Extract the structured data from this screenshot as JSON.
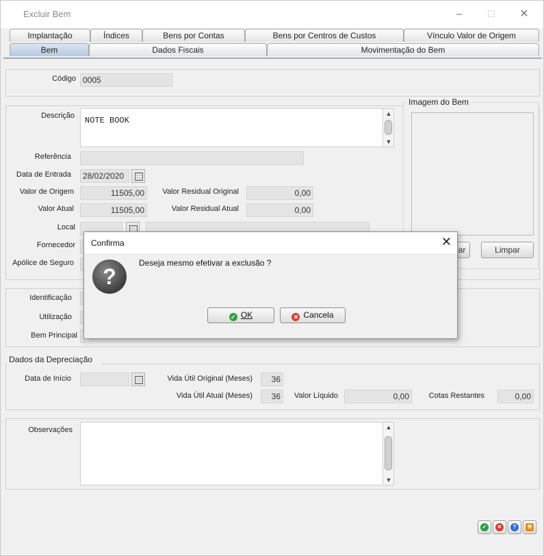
{
  "window": {
    "title": "Excluir Bem"
  },
  "tabs_row1": [
    "Implantação",
    "Índices",
    "Bens por Contas",
    "Bens por Centros de Custos",
    "Vínculo Valor de Origem"
  ],
  "tabs_row2": [
    "Bem",
    "Dados Fiscais",
    "Movimentação do Bem"
  ],
  "form": {
    "codigo": {
      "label": "Código",
      "value": "0005"
    },
    "descricao": {
      "label": "Descrição",
      "value": "NOTE BOOK"
    },
    "referencia": {
      "label": "Referência",
      "value": ""
    },
    "data_entrada": {
      "label": "Data de Entrada",
      "value": "28/02/2020"
    },
    "valor_origem": {
      "label": "Valor de Origem",
      "value": "11505,00"
    },
    "valor_atual": {
      "label": "Valor Atual",
      "value": "11505,00"
    },
    "valor_residual_original": {
      "label": "Valor Residual Original",
      "value": "0,00"
    },
    "valor_residual_atual": {
      "label": "Valor Residual Atual",
      "value": "0,00"
    },
    "local": {
      "label": "Local"
    },
    "fornecedor": {
      "label": "Fornecedor"
    },
    "apolice": {
      "label": "Apólice de Seguro"
    },
    "imagem": {
      "title": "Imagem do Bem",
      "hidden_button_label": "ar",
      "limpar_label": "Limpar"
    }
  },
  "grupo2": {
    "identificacao": "Identificação",
    "utilizacao": "Utilização",
    "bem_principal": "Bem Principal"
  },
  "depreciacao": {
    "title": "Dados da Depreciação",
    "data_inicio": {
      "label": "Data de Início",
      "value": ""
    },
    "vida_util_original": {
      "label": "Vida Útil Original (Meses)",
      "value": "36"
    },
    "vida_util_atual": {
      "label": "Vida Útil Atual (Meses)",
      "value": "36"
    },
    "valor_liquido": {
      "label": "Valor Líquido",
      "value": "0,00"
    },
    "cotas_restantes": {
      "label": "Cotas Restantes",
      "value": "0,00"
    }
  },
  "observacoes": {
    "label": "Observações",
    "value": ""
  },
  "dialog": {
    "title": "Confirma",
    "message": "Deseja mesmo efetivar a exclusão ?",
    "ok_label": "OK",
    "cancel_label": "Cancela",
    "icon": "question-icon"
  },
  "colors": {
    "ok_green": "#2ea043",
    "cancel_red": "#d83b3b",
    "help_blue": "#2f6fd6",
    "tool_orange": "#e88a1a"
  }
}
